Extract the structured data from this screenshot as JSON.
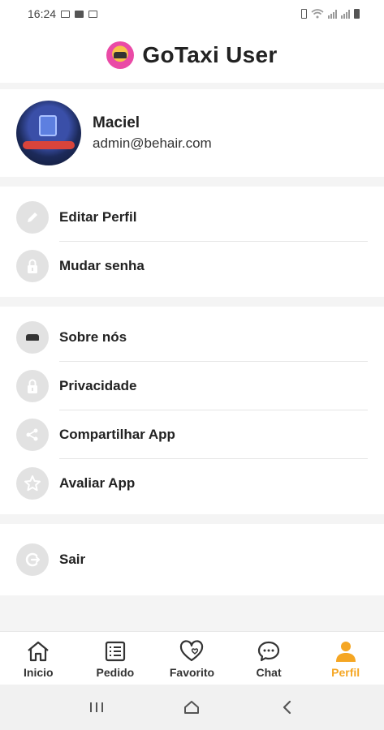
{
  "status_bar": {
    "time": "16:24"
  },
  "header": {
    "title": "GoTaxi User",
    "logo_icon": "taxi-logo-icon"
  },
  "profile": {
    "name": "Maciel",
    "email": "admin@behair.com"
  },
  "menu_group_1": [
    {
      "label": "Editar Perfil",
      "icon": "pencil-icon"
    },
    {
      "label": "Mudar senha",
      "icon": "lock-icon"
    }
  ],
  "menu_group_2": [
    {
      "label": "Sobre nós",
      "icon": "taxi-logo-icon"
    },
    {
      "label": "Privacidade",
      "icon": "lock-icon"
    },
    {
      "label": "Compartilhar App",
      "icon": "share-icon"
    },
    {
      "label": "Avaliar App",
      "icon": "star-icon"
    }
  ],
  "menu_group_3": [
    {
      "label": "Sair",
      "icon": "logout-icon"
    }
  ],
  "bottom_nav": [
    {
      "label": "Inicio",
      "icon": "home-icon"
    },
    {
      "label": "Pedido",
      "icon": "list-icon"
    },
    {
      "label": "Favorito",
      "icon": "heart-icon"
    },
    {
      "label": "Chat",
      "icon": "chat-icon"
    },
    {
      "label": "Perfil",
      "icon": "person-icon",
      "active": true
    }
  ],
  "colors": {
    "accent": "#f5a623",
    "icon_bg": "#e2e2e2",
    "icon_fg": "#ffffff"
  }
}
